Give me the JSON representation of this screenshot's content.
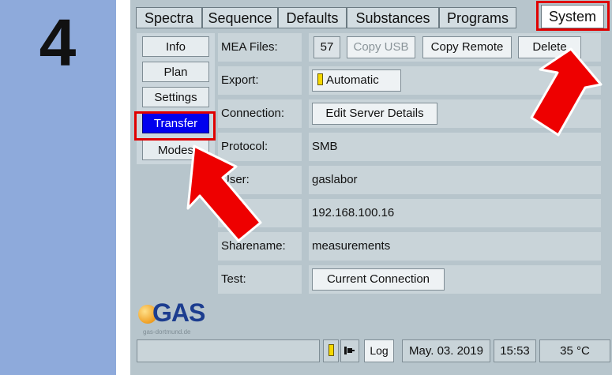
{
  "step": {
    "number": "4"
  },
  "tabs": [
    {
      "label": "Spectra"
    },
    {
      "label": "Sequence"
    },
    {
      "label": "Defaults"
    },
    {
      "label": "Substances"
    },
    {
      "label": "Programs"
    },
    {
      "label": "System",
      "selected": true
    }
  ],
  "nav": [
    {
      "label": "Info"
    },
    {
      "label": "Plan"
    },
    {
      "label": "Settings"
    },
    {
      "label": "Transfer",
      "active": true
    },
    {
      "label": "Modes"
    }
  ],
  "rows": {
    "mea_files": {
      "label": "MEA Files:",
      "count": "57",
      "copy_usb": "Copy USB",
      "copy_remote": "Copy Remote",
      "delete": "Delete"
    },
    "export": {
      "label": "Export:",
      "value": "Automatic"
    },
    "connection": {
      "label": "Connection:",
      "button": "Edit Server Details"
    },
    "protocol": {
      "label": "Protocol:",
      "value": "SMB"
    },
    "user": {
      "label": "User:",
      "value": "gaslabor"
    },
    "ip": {
      "label": "IP:",
      "value": "192.168.100.16"
    },
    "sharename": {
      "label": "Sharename:",
      "value": "measurements"
    },
    "test": {
      "label": "Test:",
      "button": "Current Connection"
    }
  },
  "logo": {
    "text": "GAS",
    "subtext": "gas-dortmund.de"
  },
  "status": {
    "log": "Log",
    "date": "May. 03. 2019",
    "time": "15:53",
    "temperature": "35 °C"
  },
  "colors": {
    "highlight": "#e00000",
    "active_nav": "#0000ee",
    "panel_bg": "#8eaadb",
    "indicator": "#f5d800"
  }
}
